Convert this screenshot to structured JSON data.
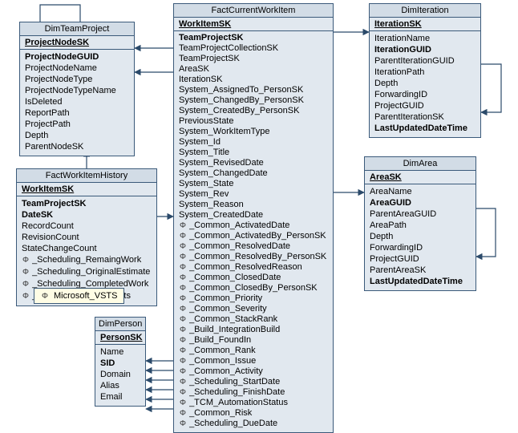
{
  "legend": {
    "glyph": "Φ",
    "label": "Microsoft_VSTS"
  },
  "entities": {
    "dimTeamProject": {
      "title": "DimTeamProject",
      "pk": "ProjectNodeSK",
      "fields": [
        {
          "text": "ProjectNodeGUID",
          "bold": true
        },
        {
          "text": "ProjectNodeName"
        },
        {
          "text": "ProjectNodeType"
        },
        {
          "text": "ProjectNodeTypeName"
        },
        {
          "text": "IsDeleted"
        },
        {
          "text": "ReportPath"
        },
        {
          "text": "ProjectPath"
        },
        {
          "text": "Depth"
        },
        {
          "text": "ParentNodeSK"
        }
      ]
    },
    "factWorkItemHistory": {
      "title": "FactWorkItemHistory",
      "pk": "WorkItemSK",
      "fields": [
        {
          "text": "TeamProjectSK",
          "bold": true
        },
        {
          "text": "DateSK",
          "bold": true
        },
        {
          "text": "RecordCount"
        },
        {
          "text": "RevisionCount"
        },
        {
          "text": "StateChangeCount"
        },
        {
          "glyph": "Φ",
          "text": "_Scheduling_RemaingWork"
        },
        {
          "glyph": "Φ",
          "text": "_Scheduling_OriginalEstimate"
        },
        {
          "glyph": "Φ",
          "text": "_Scheduling_CompletedWork"
        },
        {
          "glyph": "Φ",
          "text": "_Scheduling_StoryPoints"
        }
      ]
    },
    "dimPerson": {
      "title": "DimPerson",
      "pk": "PersonSK",
      "fields": [
        {
          "text": "Name"
        },
        {
          "text": "SID",
          "bold": true
        },
        {
          "text": "Domain"
        },
        {
          "text": "Alias"
        },
        {
          "text": "Email"
        }
      ]
    },
    "factCurrentWorkItem": {
      "title": "FactCurrentWorkItem",
      "pk": "WorkItemSK",
      "fields": [
        {
          "text": "TeamProjectSK",
          "bold": true
        },
        {
          "text": "TeamProjectCollectionSK"
        },
        {
          "text": "TeamProjectSK"
        },
        {
          "text": "AreaSK"
        },
        {
          "text": "IterationSK"
        },
        {
          "text": "System_AssignedTo_PersonSK"
        },
        {
          "text": "System_ChangedBy_PersonSK"
        },
        {
          "text": "System_CreatedBy_PersonSK"
        },
        {
          "text": "PreviousState"
        },
        {
          "text": "System_WorkItemType"
        },
        {
          "text": "System_Id"
        },
        {
          "text": "System_Title"
        },
        {
          "text": "System_RevisedDate"
        },
        {
          "text": "System_ChangedDate"
        },
        {
          "text": "System_State"
        },
        {
          "text": "System_Rev"
        },
        {
          "text": "System_Reason"
        },
        {
          "text": "System_CreatedDate"
        },
        {
          "glyph": "Φ",
          "text": "_Common_ActivatedDate"
        },
        {
          "glyph": "Φ",
          "text": "_Common_ActivatedBy_PersonSK"
        },
        {
          "glyph": "Φ",
          "text": "_Common_ResolvedDate"
        },
        {
          "glyph": "Φ",
          "text": "_Common_ResolvedBy_PersonSK"
        },
        {
          "glyph": "Φ",
          "text": "_Common_ResolvedReason"
        },
        {
          "glyph": "Φ",
          "text": "_Common_ClosedDate"
        },
        {
          "glyph": "Φ",
          "text": "_Common_ClosedBy_PersonSK"
        },
        {
          "glyph": "Φ",
          "text": "_Common_Priority"
        },
        {
          "glyph": "Φ",
          "text": "_Common_Severity"
        },
        {
          "glyph": "Φ",
          "text": "_Common_StackRank"
        },
        {
          "glyph": "Φ",
          "text": "_Build_IntegrationBuild"
        },
        {
          "glyph": "Φ",
          "text": "_Build_FoundIn"
        },
        {
          "glyph": "Φ",
          "text": "_Common_Rank"
        },
        {
          "glyph": "Φ",
          "text": "_Common_Issue"
        },
        {
          "glyph": "Φ",
          "text": "_Common_Activity"
        },
        {
          "glyph": "Φ",
          "text": "_Scheduling_StartDate"
        },
        {
          "glyph": "Φ",
          "text": "_Scheduling_FinishDate"
        },
        {
          "glyph": "Φ",
          "text": "_TCM_AutomationStatus"
        },
        {
          "glyph": "Φ",
          "text": "_Common_Risk"
        },
        {
          "glyph": "Φ",
          "text": "_Scheduling_DueDate"
        }
      ]
    },
    "dimIteration": {
      "title": "DimIteration",
      "pk": "IterationSK",
      "fields": [
        {
          "text": "IterationName"
        },
        {
          "text": "IterationGUID",
          "bold": true
        },
        {
          "text": "ParentIterationGUID"
        },
        {
          "text": "IterationPath"
        },
        {
          "text": "Depth"
        },
        {
          "text": "ForwardingID"
        },
        {
          "text": "ProjectGUID"
        },
        {
          "text": "ParentIterationSK"
        },
        {
          "text": "LastUpdatedDateTime",
          "bold": true
        }
      ]
    },
    "dimArea": {
      "title": "DimArea",
      "pk": "AreaSK",
      "fields": [
        {
          "text": "AreaName"
        },
        {
          "text": "AreaGUID",
          "bold": true
        },
        {
          "text": "ParentAreaGUID"
        },
        {
          "text": "AreaPath"
        },
        {
          "text": "Depth"
        },
        {
          "text": "ForwardingID"
        },
        {
          "text": "ProjectGUID"
        },
        {
          "text": "ParentAreaSK"
        },
        {
          "text": "LastUpdatedDateTime",
          "bold": true
        }
      ]
    }
  }
}
